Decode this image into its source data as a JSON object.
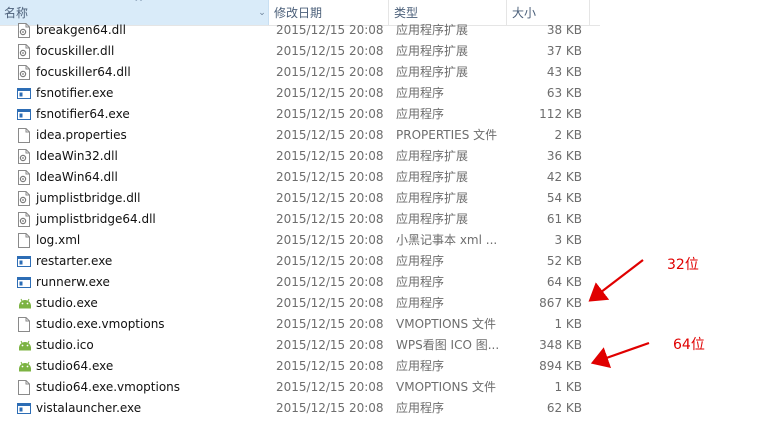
{
  "header": {
    "name": "名称",
    "date": "修改日期",
    "type": "类型",
    "size": "大小"
  },
  "files": [
    {
      "name": "breakgen64.dll",
      "date": "2015/12/15 20:08",
      "type": "应用程序扩展",
      "size": "38 KB",
      "icon": "dll-icon"
    },
    {
      "name": "focuskiller.dll",
      "date": "2015/12/15 20:08",
      "type": "应用程序扩展",
      "size": "37 KB",
      "icon": "dll-icon"
    },
    {
      "name": "focuskiller64.dll",
      "date": "2015/12/15 20:08",
      "type": "应用程序扩展",
      "size": "43 KB",
      "icon": "dll-icon"
    },
    {
      "name": "fsnotifier.exe",
      "date": "2015/12/15 20:08",
      "type": "应用程序",
      "size": "63 KB",
      "icon": "exe-icon"
    },
    {
      "name": "fsnotifier64.exe",
      "date": "2015/12/15 20:08",
      "type": "应用程序",
      "size": "112 KB",
      "icon": "exe-icon"
    },
    {
      "name": "idea.properties",
      "date": "2015/12/15 20:08",
      "type": "PROPERTIES 文件",
      "size": "2 KB",
      "icon": "file-icon"
    },
    {
      "name": "IdeaWin32.dll",
      "date": "2015/12/15 20:08",
      "type": "应用程序扩展",
      "size": "36 KB",
      "icon": "dll-icon"
    },
    {
      "name": "IdeaWin64.dll",
      "date": "2015/12/15 20:08",
      "type": "应用程序扩展",
      "size": "42 KB",
      "icon": "dll-icon"
    },
    {
      "name": "jumplistbridge.dll",
      "date": "2015/12/15 20:08",
      "type": "应用程序扩展",
      "size": "54 KB",
      "icon": "dll-icon"
    },
    {
      "name": "jumplistbridge64.dll",
      "date": "2015/12/15 20:08",
      "type": "应用程序扩展",
      "size": "61 KB",
      "icon": "dll-icon"
    },
    {
      "name": "log.xml",
      "date": "2015/12/15 20:08",
      "type": "小黑记事本 xml ...",
      "size": "3 KB",
      "icon": "file-icon"
    },
    {
      "name": "restarter.exe",
      "date": "2015/12/15 20:08",
      "type": "应用程序",
      "size": "52 KB",
      "icon": "exe-icon"
    },
    {
      "name": "runnerw.exe",
      "date": "2015/12/15 20:08",
      "type": "应用程序",
      "size": "64 KB",
      "icon": "exe-icon"
    },
    {
      "name": "studio.exe",
      "date": "2015/12/15 20:08",
      "type": "应用程序",
      "size": "867 KB",
      "icon": "android-icon"
    },
    {
      "name": "studio.exe.vmoptions",
      "date": "2015/12/15 20:08",
      "type": "VMOPTIONS 文件",
      "size": "1 KB",
      "icon": "file-icon"
    },
    {
      "name": "studio.ico",
      "date": "2015/12/15 20:08",
      "type": "WPS看图 ICO 图...",
      "size": "348 KB",
      "icon": "android-icon"
    },
    {
      "name": "studio64.exe",
      "date": "2015/12/15 20:08",
      "type": "应用程序",
      "size": "894 KB",
      "icon": "android-icon"
    },
    {
      "name": "studio64.exe.vmoptions",
      "date": "2015/12/15 20:08",
      "type": "VMOPTIONS 文件",
      "size": "1 KB",
      "icon": "file-icon"
    },
    {
      "name": "vistalauncher.exe",
      "date": "2015/12/15 20:08",
      "type": "应用程序",
      "size": "62 KB",
      "icon": "exe-icon"
    }
  ],
  "annotations": {
    "label_32": "32位",
    "label_64": "64位",
    "color": "#e00000"
  }
}
